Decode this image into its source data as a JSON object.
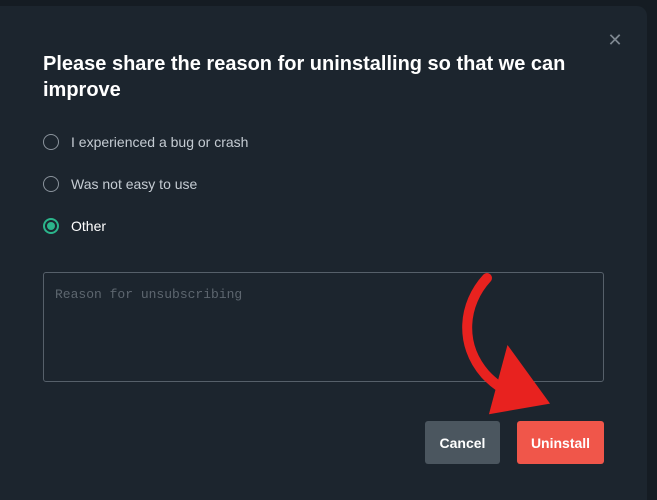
{
  "dialog": {
    "title": "Please share the reason for uninstalling so that we can improve",
    "close_icon": "close-icon"
  },
  "reasons": {
    "options": [
      {
        "label": "I experienced a bug or crash",
        "selected": false
      },
      {
        "label": "Was not easy to use",
        "selected": false
      },
      {
        "label": "Other",
        "selected": true
      }
    ]
  },
  "reason_input": {
    "placeholder": "Reason for unsubscribing",
    "value": ""
  },
  "buttons": {
    "cancel_label": "Cancel",
    "uninstall_label": "Uninstall"
  },
  "colors": {
    "dialog_bg": "#1c252e",
    "accent_radio": "#2bb58b",
    "uninstall_bg": "#f0564a",
    "cancel_bg": "#4b565f",
    "annotation_arrow": "#e8221f"
  }
}
